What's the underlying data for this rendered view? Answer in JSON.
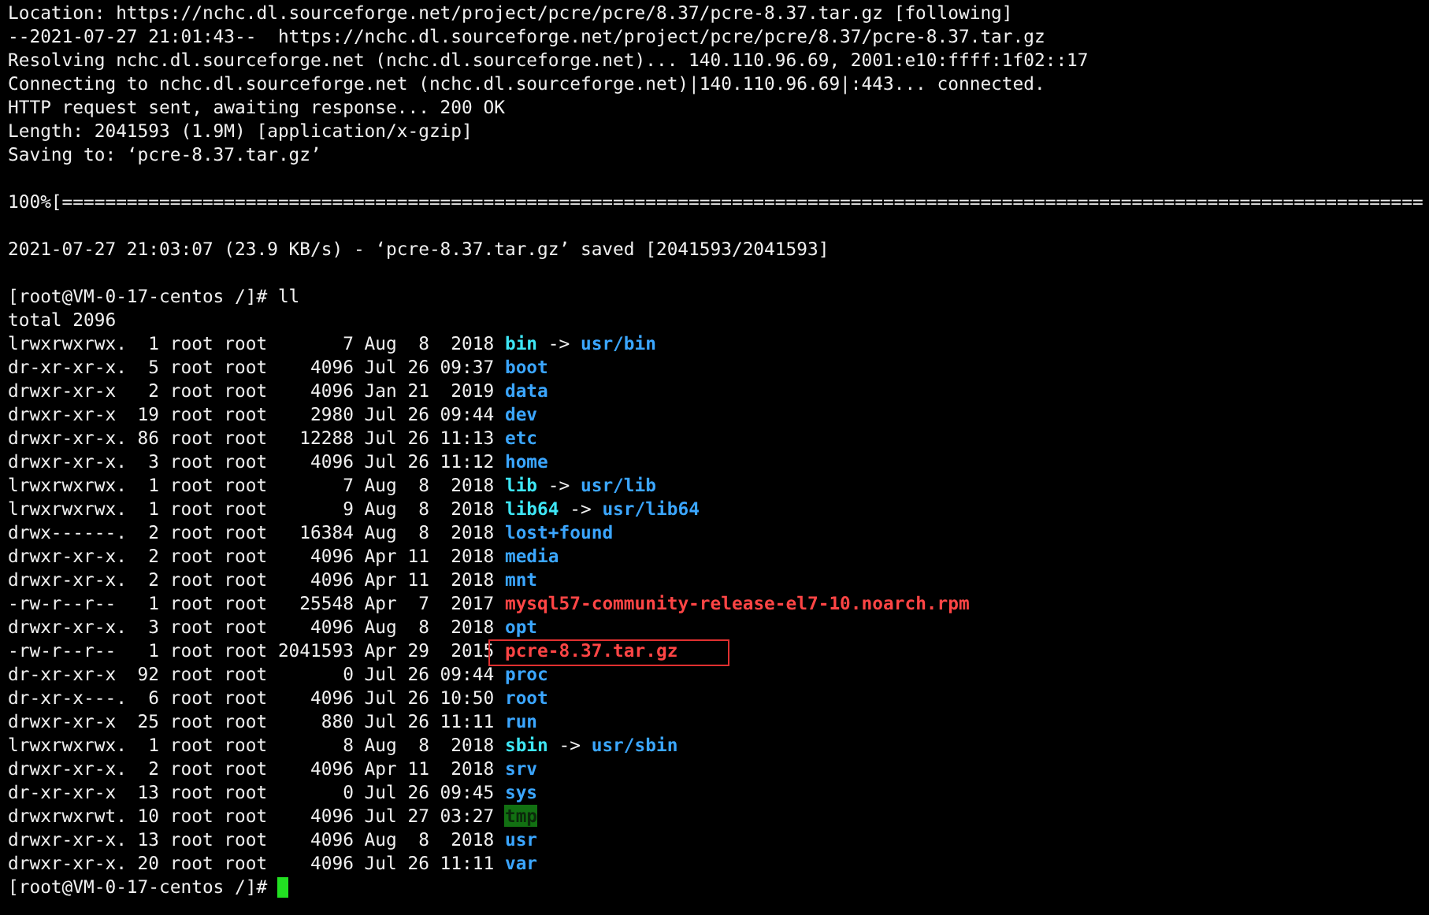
{
  "download_log": [
    "Location: https://nchc.dl.sourceforge.net/project/pcre/pcre/8.37/pcre-8.37.tar.gz [following]",
    "--2021-07-27 21:01:43--  https://nchc.dl.sourceforge.net/project/pcre/pcre/8.37/pcre-8.37.tar.gz",
    "Resolving nchc.dl.sourceforge.net (nchc.dl.sourceforge.net)... 140.110.96.69, 2001:e10:ffff:1f02::17",
    "Connecting to nchc.dl.sourceforge.net (nchc.dl.sourceforge.net)|140.110.96.69|:443... connected.",
    "HTTP request sent, awaiting response... 200 OK",
    "Length: 2041593 (1.9M) [application/x-gzip]",
    "Saving to: ‘pcre-8.37.tar.gz’"
  ],
  "progress": "100%[==============================================================================================================================",
  "saved_line": "2021-07-27 21:03:07 (23.9 KB/s) - ‘pcre-8.37.tar.gz’ saved [2041593/2041593]",
  "command_line": "[root@VM-0-17-centos /]# ll",
  "total": "total 2096",
  "entries": [
    {
      "info": "lrwxrwxrwx.  1 root root       7 Aug  8  2018",
      "name": "bin",
      "kind": "link",
      "arrow": "->",
      "target": "usr/bin",
      "highlighted": false
    },
    {
      "info": "dr-xr-xr-x.  5 root root    4096 Jul 26 09:37",
      "name": "boot",
      "kind": "dir",
      "highlighted": false
    },
    {
      "info": "drwxr-xr-x   2 root root    4096 Jan 21  2019",
      "name": "data",
      "kind": "dir",
      "highlighted": false
    },
    {
      "info": "drwxr-xr-x  19 root root    2980 Jul 26 09:44",
      "name": "dev",
      "kind": "dir",
      "highlighted": false
    },
    {
      "info": "drwxr-xr-x. 86 root root   12288 Jul 26 11:13",
      "name": "etc",
      "kind": "dir",
      "highlighted": false
    },
    {
      "info": "drwxr-xr-x.  3 root root    4096 Jul 26 11:12",
      "name": "home",
      "kind": "dir",
      "highlighted": false
    },
    {
      "info": "lrwxrwxrwx.  1 root root       7 Aug  8  2018",
      "name": "lib",
      "kind": "link",
      "arrow": "->",
      "target": "usr/lib",
      "highlighted": false
    },
    {
      "info": "lrwxrwxrwx.  1 root root       9 Aug  8  2018",
      "name": "lib64",
      "kind": "link",
      "arrow": "->",
      "target": "usr/lib64",
      "highlighted": false
    },
    {
      "info": "drwx------.  2 root root   16384 Aug  8  2018",
      "name": "lost+found",
      "kind": "dir",
      "highlighted": false
    },
    {
      "info": "drwxr-xr-x.  2 root root    4096 Apr 11  2018",
      "name": "media",
      "kind": "dir",
      "highlighted": false
    },
    {
      "info": "drwxr-xr-x.  2 root root    4096 Apr 11  2018",
      "name": "mnt",
      "kind": "dir",
      "highlighted": false
    },
    {
      "info": "-rw-r--r--   1 root root   25548 Apr  7  2017",
      "name": "mysql57-community-release-el7-10.noarch.rpm",
      "kind": "archive",
      "highlighted": false
    },
    {
      "info": "drwxr-xr-x.  3 root root    4096 Aug  8  2018",
      "name": "opt",
      "kind": "dir",
      "highlighted": false
    },
    {
      "info": "-rw-r--r--   1 root root 2041593 Apr 29  2015",
      "name": "pcre-8.37.tar.gz",
      "kind": "archive",
      "highlighted": true
    },
    {
      "info": "dr-xr-xr-x  92 root root       0 Jul 26 09:44",
      "name": "proc",
      "kind": "dir",
      "highlighted": false
    },
    {
      "info": "dr-xr-x---.  6 root root    4096 Jul 26 10:50",
      "name": "root",
      "kind": "dir",
      "highlighted": false
    },
    {
      "info": "drwxr-xr-x  25 root root     880 Jul 26 11:11",
      "name": "run",
      "kind": "dir",
      "highlighted": false
    },
    {
      "info": "lrwxrwxrwx.  1 root root       8 Aug  8  2018",
      "name": "sbin",
      "kind": "link",
      "arrow": "->",
      "target": "usr/sbin",
      "highlighted": false
    },
    {
      "info": "drwxr-xr-x.  2 root root    4096 Apr 11  2018",
      "name": "srv",
      "kind": "dir",
      "highlighted": false
    },
    {
      "info": "dr-xr-xr-x  13 root root       0 Jul 26 09:45",
      "name": "sys",
      "kind": "dir",
      "highlighted": false
    },
    {
      "info": "drwxrwxrwt. 10 root root    4096 Jul 27 03:27",
      "name": "tmp",
      "kind": "sticky",
      "highlighted": false
    },
    {
      "info": "drwxr-xr-x. 13 root root    4096 Aug  8  2018",
      "name": "usr",
      "kind": "dir",
      "highlighted": false
    },
    {
      "info": "drwxr-xr-x. 20 root root    4096 Jul 26 11:11",
      "name": "var",
      "kind": "dir",
      "highlighted": false
    }
  ],
  "final_prompt": {
    "text": "[root@VM-0-17-centos /]#",
    "cursor": true
  }
}
